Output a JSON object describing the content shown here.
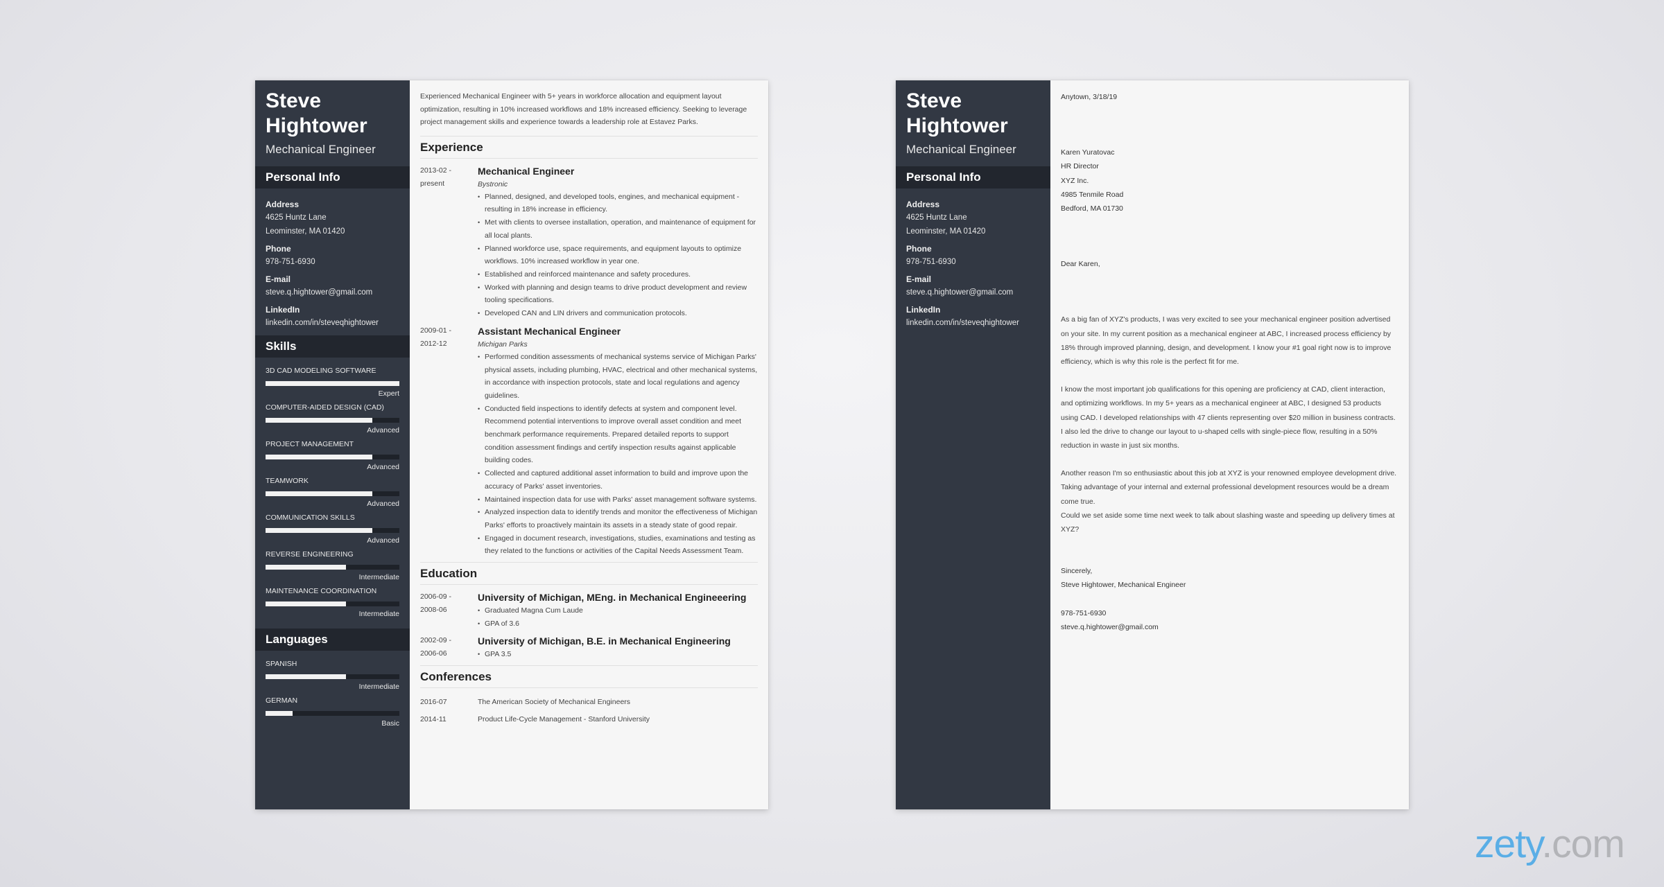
{
  "resume": {
    "first_name": "Steve",
    "last_name": "Hightower",
    "title": "Mechanical Engineer",
    "personal_info_heading": "Personal Info",
    "personal_info": [
      {
        "label": "Address",
        "lines": [
          "4625 Huntz Lane",
          "Leominster, MA 01420"
        ]
      },
      {
        "label": "Phone",
        "lines": [
          "978-751-6930"
        ]
      },
      {
        "label": "E-mail",
        "lines": [
          "steve.q.hightower@gmail.com"
        ]
      },
      {
        "label": "LinkedIn",
        "lines": [
          "linkedin.com/in/steveqhightower"
        ]
      }
    ],
    "skills_heading": "Skills",
    "skills": [
      {
        "name": "3D CAD MODELING SOFTWARE",
        "level": "Expert",
        "fill": 1.0
      },
      {
        "name": "COMPUTER-AIDED DESIGN (CAD)",
        "level": "Advanced",
        "fill": 0.8
      },
      {
        "name": "PROJECT MANAGEMENT",
        "level": "Advanced",
        "fill": 0.8
      },
      {
        "name": "TEAMWORK",
        "level": "Advanced",
        "fill": 0.8
      },
      {
        "name": "COMMUNICATION SKILLS",
        "level": "Advanced",
        "fill": 0.8
      },
      {
        "name": "REVERSE ENGINEERING",
        "level": "Intermediate",
        "fill": 0.6
      },
      {
        "name": "MAINTENANCE COORDINATION",
        "level": "Intermediate",
        "fill": 0.6
      }
    ],
    "languages_heading": "Languages",
    "languages": [
      {
        "name": "SPANISH",
        "level": "Intermediate",
        "fill": 0.6
      },
      {
        "name": "GERMAN",
        "level": "Basic",
        "fill": 0.2
      }
    ],
    "summary": "Experienced Mechanical Engineer with 5+ years in workforce allocation and equipment layout optimization, resulting in 10% increased workflows and 18% increased efficiency. Seeking to leverage project management skills and experience towards a leadership role at Estavez Parks.",
    "experience_heading": "Experience",
    "experience": [
      {
        "date_start": "2013-02 -",
        "date_end": "present",
        "title": "Mechanical Engineer",
        "org": "Bystronic",
        "bullets": [
          "Planned, designed, and developed tools, engines, and mechanical equipment - resulting in 18% increase in efficiency.",
          "Met with clients to oversee installation, operation, and maintenance of equipment for all local plants.",
          "Planned workforce use, space requirements, and equipment layouts to optimize workflows. 10% increased workflow in year one.",
          "Established and reinforced maintenance and safety procedures.",
          "Worked with planning and design teams to drive product development and review tooling specifications.",
          "Developed CAN and LIN drivers and communication protocols."
        ]
      },
      {
        "date_start": "2009-01 -",
        "date_end": "2012-12",
        "title": "Assistant Mechanical Engineer",
        "org": "Michigan Parks",
        "bullets": [
          "Performed condition assessments of mechanical systems service of Michigan Parks' physical assets, including plumbing, HVAC, electrical and other mechanical systems, in accordance with inspection protocols, state and local regulations and agency guidelines.",
          "Conducted field inspections to identify defects at system and component level. Recommend potential interventions to improve overall asset condition and meet benchmark performance requirements. Prepared detailed reports to support condition assessment findings and certify inspection results against applicable building codes.",
          "Collected and captured additional asset information to build and improve upon the accuracy of Parks' asset inventories.",
          "Maintained inspection data for use with Parks' asset management software systems.",
          "Analyzed inspection data to identify trends and monitor the effectiveness of Michigan Parks' efforts to proactively maintain its assets in a steady state of good repair.",
          "Engaged in document research, investigations, studies, examinations and testing as they related to the functions or activities of the Capital Needs Assessment Team."
        ]
      }
    ],
    "education_heading": "Education",
    "education": [
      {
        "date_start": "2006-09 -",
        "date_end": "2008-06",
        "title": "University of Michigan, MEng. in Mechanical Engineeering",
        "bullets": [
          "Graduated Magna Cum Laude",
          "GPA of 3.6"
        ]
      },
      {
        "date_start": "2002-09 -",
        "date_end": "2006-06",
        "title": "University of Michigan, B.E. in Mechanical Engineering",
        "bullets": [
          "GPA 3.5"
        ]
      }
    ],
    "conferences_heading": "Conferences",
    "conferences": [
      {
        "date": "2016-07",
        "name": "The American Society of Mechanical Engineers"
      },
      {
        "date": "2014-11",
        "name": "Product Life-Cycle Management - Stanford University"
      }
    ]
  },
  "letter": {
    "place_date": "Anytown, 3/18/19",
    "recipient": [
      "Karen Yuratovac",
      "HR Director",
      "XYZ Inc.",
      "4985 Tenmile Road",
      "Bedford, MA 01730"
    ],
    "salutation": "Dear Karen,",
    "paragraphs": [
      "As a big fan of XYZ's products, I was very excited to see your mechanical engineer position advertised on your site. In my current position as a mechanical engineer at ABC, I increased process efficiency by 18% through improved planning, design, and development. I know your #1 goal right now is to improve efficiency, which is why this role is the perfect fit for me.",
      "I know the most important job qualifications for this opening are proficiency at CAD, client interaction, and optimizing workflows. In my 5+ years as a mechanical engineer at ABC, I designed 53 products using CAD. I developed relationships with 47 clients representing over $20 million in business contracts. I also led the drive to change our layout to u-shaped cells with single-piece flow, resulting in a 50% reduction in waste in just six months.",
      "Another reason I'm so enthusiastic about this job at XYZ is your renowned employee development drive. Taking advantage of your internal and external professional development resources would be a dream come true.",
      "Could we set aside some time next week to talk about slashing waste and speeding up delivery times at XYZ?"
    ],
    "closing": "Sincerely,",
    "signature": "Steve Hightower, Mechanical Engineer",
    "phone": "978-751-6930",
    "email": "steve.q.hightower@gmail.com"
  },
  "branding": {
    "logo_main": "zety",
    "logo_suffix": ".com",
    "logo_color": "#5aaee6",
    "sidebar_color": "#323843"
  }
}
